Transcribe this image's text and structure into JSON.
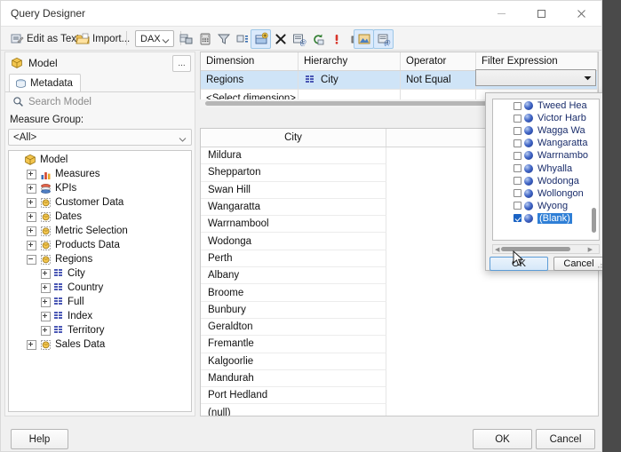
{
  "window": {
    "title": "Query Designer",
    "minimize_label": "Minimize",
    "maximize_label": "Maximize",
    "close_label": "Close"
  },
  "toolbar": {
    "edit_as_text": "Edit as Text",
    "import": "Import...",
    "query_language": "DAX",
    "buttons": [
      {
        "name": "add-calculated-member-icon",
        "title": "Add Calculated Member"
      },
      {
        "name": "calculator-icon",
        "title": "Calculator"
      },
      {
        "name": "filter-icon",
        "title": "Filter"
      },
      {
        "name": "auto-execute-icon",
        "title": "Auto Execute"
      },
      {
        "name": "add-field-icon",
        "title": "Add Field",
        "active": true
      },
      {
        "name": "delete-icon",
        "title": "Delete"
      },
      {
        "name": "edit-query-icon",
        "title": "Edit Query"
      },
      {
        "name": "refresh-icon",
        "title": "Refresh Fields"
      },
      {
        "name": "exclamation-run-icon",
        "title": "Execute Query"
      },
      {
        "name": "stop-icon",
        "title": "Cancel Query"
      },
      {
        "name": "design-mode-icon",
        "title": "Design Mode",
        "active": true
      },
      {
        "name": "query-parameters-icon",
        "title": "Query Parameters",
        "active": true
      }
    ]
  },
  "metadata_panel": {
    "header": "Model",
    "options_label": "...",
    "tab": "Metadata",
    "search_placeholder": "Search Model",
    "measure_group_label": "Measure Group:",
    "measure_group_value": "<All>",
    "tree": [
      {
        "label": "Model",
        "indent": 0,
        "icon": "cube-icon",
        "expander": "none"
      },
      {
        "label": "Measures",
        "indent": 1,
        "icon": "measures-icon",
        "expander": "plus"
      },
      {
        "label": "KPIs",
        "indent": 1,
        "icon": "kpi-icon",
        "expander": "plus"
      },
      {
        "label": "Customer Data",
        "indent": 1,
        "icon": "table-icon",
        "expander": "plus"
      },
      {
        "label": "Dates",
        "indent": 1,
        "icon": "table-icon",
        "expander": "plus"
      },
      {
        "label": "Metric Selection",
        "indent": 1,
        "icon": "table-icon",
        "expander": "plus"
      },
      {
        "label": "Products Data",
        "indent": 1,
        "icon": "table-icon",
        "expander": "plus"
      },
      {
        "label": "Regions",
        "indent": 1,
        "icon": "table-icon",
        "expander": "minus"
      },
      {
        "label": "City",
        "indent": 2,
        "icon": "field-icon",
        "expander": "plus"
      },
      {
        "label": "Country",
        "indent": 2,
        "icon": "field-icon",
        "expander": "plus"
      },
      {
        "label": "Full",
        "indent": 2,
        "icon": "field-icon",
        "expander": "plus"
      },
      {
        "label": "Index",
        "indent": 2,
        "icon": "field-icon",
        "expander": "plus"
      },
      {
        "label": "Territory",
        "indent": 2,
        "icon": "field-icon",
        "expander": "plus"
      },
      {
        "label": "Sales Data",
        "indent": 1,
        "icon": "table-icon",
        "expander": "plus"
      }
    ]
  },
  "filter_grid": {
    "columns": [
      "Dimension",
      "Hierarchy",
      "Operator",
      "Filter Expression"
    ],
    "rows": [
      {
        "dimension": "Regions",
        "hierarchy": "City",
        "operator": "Not Equal",
        "filter_expression": "",
        "selected": true
      },
      {
        "dimension": "<Select dimension>",
        "hierarchy": "",
        "operator": "",
        "filter_expression": "",
        "selected": false
      }
    ]
  },
  "result_grid": {
    "column": "City",
    "rows": [
      "Mildura",
      "Shepparton",
      "Swan Hill",
      "Wangaratta",
      "Warrnambool",
      "Wodonga",
      "Perth",
      "Albany",
      "Broome",
      "Bunbury",
      "Geraldton",
      "Fremantle",
      "Kalgoorlie",
      "Mandurah",
      "Port Hedland",
      "(null)"
    ]
  },
  "filter_popup": {
    "items": [
      {
        "label": "Tweed Hea",
        "checked": false,
        "selected": false
      },
      {
        "label": "Victor Harb",
        "checked": false,
        "selected": false
      },
      {
        "label": "Wagga Wa",
        "checked": false,
        "selected": false
      },
      {
        "label": "Wangaratta",
        "checked": false,
        "selected": false
      },
      {
        "label": "Warrnambo",
        "checked": false,
        "selected": false
      },
      {
        "label": "Whyalla",
        "checked": false,
        "selected": false
      },
      {
        "label": "Wodonga",
        "checked": false,
        "selected": false
      },
      {
        "label": "Wollongon",
        "checked": false,
        "selected": false
      },
      {
        "label": "Wyong",
        "checked": false,
        "selected": false
      },
      {
        "label": "(Blank)",
        "checked": true,
        "selected": true
      }
    ],
    "ok_label": "OK",
    "cancel_label": "Cancel"
  },
  "footer": {
    "help": "Help",
    "ok": "OK",
    "cancel": "Cancel"
  },
  "colors": {
    "selection_blue": "#cfe4f7",
    "highlight_blue": "#2f7fd6",
    "checkbox_checked": "#1a63c4",
    "accent_border": "#5d9cd6"
  }
}
